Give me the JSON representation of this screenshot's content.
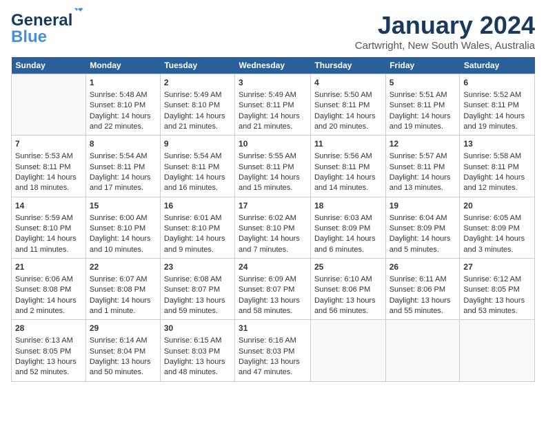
{
  "logo": {
    "general": "General",
    "blue": "Blue"
  },
  "header": {
    "title": "January 2024",
    "subtitle": "Cartwright, New South Wales, Australia"
  },
  "days_of_week": [
    "Sunday",
    "Monday",
    "Tuesday",
    "Wednesday",
    "Thursday",
    "Friday",
    "Saturday"
  ],
  "weeks": [
    [
      {
        "day": "",
        "sunrise": "",
        "sunset": "",
        "daylight": ""
      },
      {
        "day": "1",
        "sunrise": "Sunrise: 5:48 AM",
        "sunset": "Sunset: 8:10 PM",
        "daylight": "Daylight: 14 hours and 22 minutes."
      },
      {
        "day": "2",
        "sunrise": "Sunrise: 5:49 AM",
        "sunset": "Sunset: 8:10 PM",
        "daylight": "Daylight: 14 hours and 21 minutes."
      },
      {
        "day": "3",
        "sunrise": "Sunrise: 5:49 AM",
        "sunset": "Sunset: 8:11 PM",
        "daylight": "Daylight: 14 hours and 21 minutes."
      },
      {
        "day": "4",
        "sunrise": "Sunrise: 5:50 AM",
        "sunset": "Sunset: 8:11 PM",
        "daylight": "Daylight: 14 hours and 20 minutes."
      },
      {
        "day": "5",
        "sunrise": "Sunrise: 5:51 AM",
        "sunset": "Sunset: 8:11 PM",
        "daylight": "Daylight: 14 hours and 19 minutes."
      },
      {
        "day": "6",
        "sunrise": "Sunrise: 5:52 AM",
        "sunset": "Sunset: 8:11 PM",
        "daylight": "Daylight: 14 hours and 19 minutes."
      }
    ],
    [
      {
        "day": "7",
        "sunrise": "Sunrise: 5:53 AM",
        "sunset": "Sunset: 8:11 PM",
        "daylight": "Daylight: 14 hours and 18 minutes."
      },
      {
        "day": "8",
        "sunrise": "Sunrise: 5:54 AM",
        "sunset": "Sunset: 8:11 PM",
        "daylight": "Daylight: 14 hours and 17 minutes."
      },
      {
        "day": "9",
        "sunrise": "Sunrise: 5:54 AM",
        "sunset": "Sunset: 8:11 PM",
        "daylight": "Daylight: 14 hours and 16 minutes."
      },
      {
        "day": "10",
        "sunrise": "Sunrise: 5:55 AM",
        "sunset": "Sunset: 8:11 PM",
        "daylight": "Daylight: 14 hours and 15 minutes."
      },
      {
        "day": "11",
        "sunrise": "Sunrise: 5:56 AM",
        "sunset": "Sunset: 8:11 PM",
        "daylight": "Daylight: 14 hours and 14 minutes."
      },
      {
        "day": "12",
        "sunrise": "Sunrise: 5:57 AM",
        "sunset": "Sunset: 8:11 PM",
        "daylight": "Daylight: 14 hours and 13 minutes."
      },
      {
        "day": "13",
        "sunrise": "Sunrise: 5:58 AM",
        "sunset": "Sunset: 8:11 PM",
        "daylight": "Daylight: 14 hours and 12 minutes."
      }
    ],
    [
      {
        "day": "14",
        "sunrise": "Sunrise: 5:59 AM",
        "sunset": "Sunset: 8:10 PM",
        "daylight": "Daylight: 14 hours and 11 minutes."
      },
      {
        "day": "15",
        "sunrise": "Sunrise: 6:00 AM",
        "sunset": "Sunset: 8:10 PM",
        "daylight": "Daylight: 14 hours and 10 minutes."
      },
      {
        "day": "16",
        "sunrise": "Sunrise: 6:01 AM",
        "sunset": "Sunset: 8:10 PM",
        "daylight": "Daylight: 14 hours and 9 minutes."
      },
      {
        "day": "17",
        "sunrise": "Sunrise: 6:02 AM",
        "sunset": "Sunset: 8:10 PM",
        "daylight": "Daylight: 14 hours and 7 minutes."
      },
      {
        "day": "18",
        "sunrise": "Sunrise: 6:03 AM",
        "sunset": "Sunset: 8:09 PM",
        "daylight": "Daylight: 14 hours and 6 minutes."
      },
      {
        "day": "19",
        "sunrise": "Sunrise: 6:04 AM",
        "sunset": "Sunset: 8:09 PM",
        "daylight": "Daylight: 14 hours and 5 minutes."
      },
      {
        "day": "20",
        "sunrise": "Sunrise: 6:05 AM",
        "sunset": "Sunset: 8:09 PM",
        "daylight": "Daylight: 14 hours and 3 minutes."
      }
    ],
    [
      {
        "day": "21",
        "sunrise": "Sunrise: 6:06 AM",
        "sunset": "Sunset: 8:08 PM",
        "daylight": "Daylight: 14 hours and 2 minutes."
      },
      {
        "day": "22",
        "sunrise": "Sunrise: 6:07 AM",
        "sunset": "Sunset: 8:08 PM",
        "daylight": "Daylight: 14 hours and 1 minute."
      },
      {
        "day": "23",
        "sunrise": "Sunrise: 6:08 AM",
        "sunset": "Sunset: 8:07 PM",
        "daylight": "Daylight: 13 hours and 59 minutes."
      },
      {
        "day": "24",
        "sunrise": "Sunrise: 6:09 AM",
        "sunset": "Sunset: 8:07 PM",
        "daylight": "Daylight: 13 hours and 58 minutes."
      },
      {
        "day": "25",
        "sunrise": "Sunrise: 6:10 AM",
        "sunset": "Sunset: 8:06 PM",
        "daylight": "Daylight: 13 hours and 56 minutes."
      },
      {
        "day": "26",
        "sunrise": "Sunrise: 6:11 AM",
        "sunset": "Sunset: 8:06 PM",
        "daylight": "Daylight: 13 hours and 55 minutes."
      },
      {
        "day": "27",
        "sunrise": "Sunrise: 6:12 AM",
        "sunset": "Sunset: 8:05 PM",
        "daylight": "Daylight: 13 hours and 53 minutes."
      }
    ],
    [
      {
        "day": "28",
        "sunrise": "Sunrise: 6:13 AM",
        "sunset": "Sunset: 8:05 PM",
        "daylight": "Daylight: 13 hours and 52 minutes."
      },
      {
        "day": "29",
        "sunrise": "Sunrise: 6:14 AM",
        "sunset": "Sunset: 8:04 PM",
        "daylight": "Daylight: 13 hours and 50 minutes."
      },
      {
        "day": "30",
        "sunrise": "Sunrise: 6:15 AM",
        "sunset": "Sunset: 8:03 PM",
        "daylight": "Daylight: 13 hours and 48 minutes."
      },
      {
        "day": "31",
        "sunrise": "Sunrise: 6:16 AM",
        "sunset": "Sunset: 8:03 PM",
        "daylight": "Daylight: 13 hours and 47 minutes."
      },
      {
        "day": "",
        "sunrise": "",
        "sunset": "",
        "daylight": ""
      },
      {
        "day": "",
        "sunrise": "",
        "sunset": "",
        "daylight": ""
      },
      {
        "day": "",
        "sunrise": "",
        "sunset": "",
        "daylight": ""
      }
    ]
  ]
}
